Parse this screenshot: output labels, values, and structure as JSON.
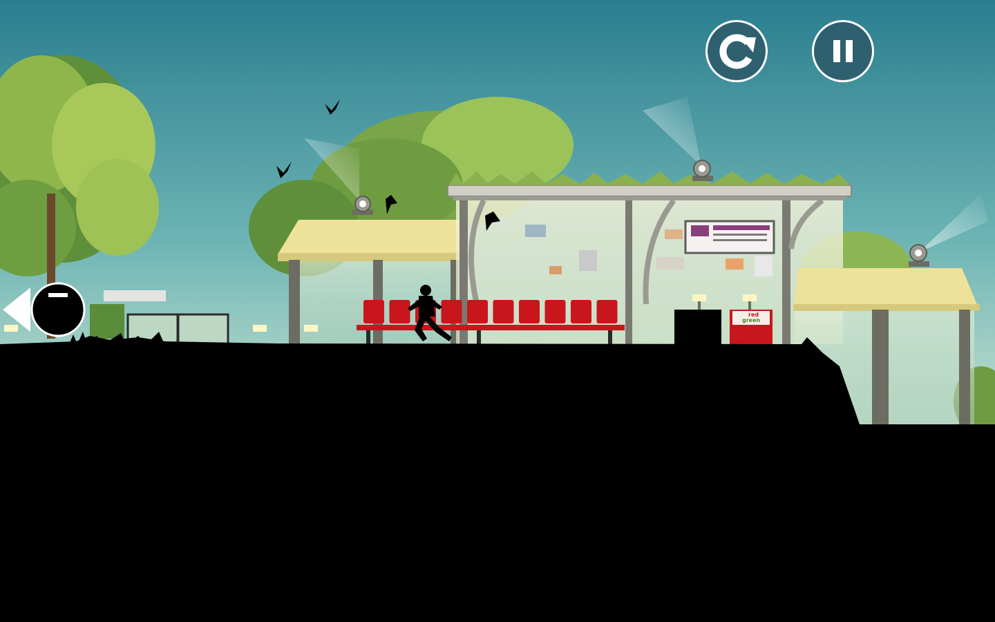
{
  "game": {
    "scene": "bus-station-rooftop-run",
    "hud": {
      "restart_icon": "restart-icon",
      "pause_icon": "pause-icon",
      "chase_indicator_icon": "hunter-offscreen-left-arrow-icon"
    },
    "sign": {
      "line1": "red",
      "line2": "green"
    },
    "colors": {
      "sky_top": "#2a7e8e",
      "sky_bottom": "#b8dccf",
      "hud_button_fill": "#2f6070",
      "hud_button_outline": "#ffffff",
      "seat_red": "#c8161c",
      "canopy_yellow": "#eee29a",
      "ground": "#000000"
    }
  }
}
